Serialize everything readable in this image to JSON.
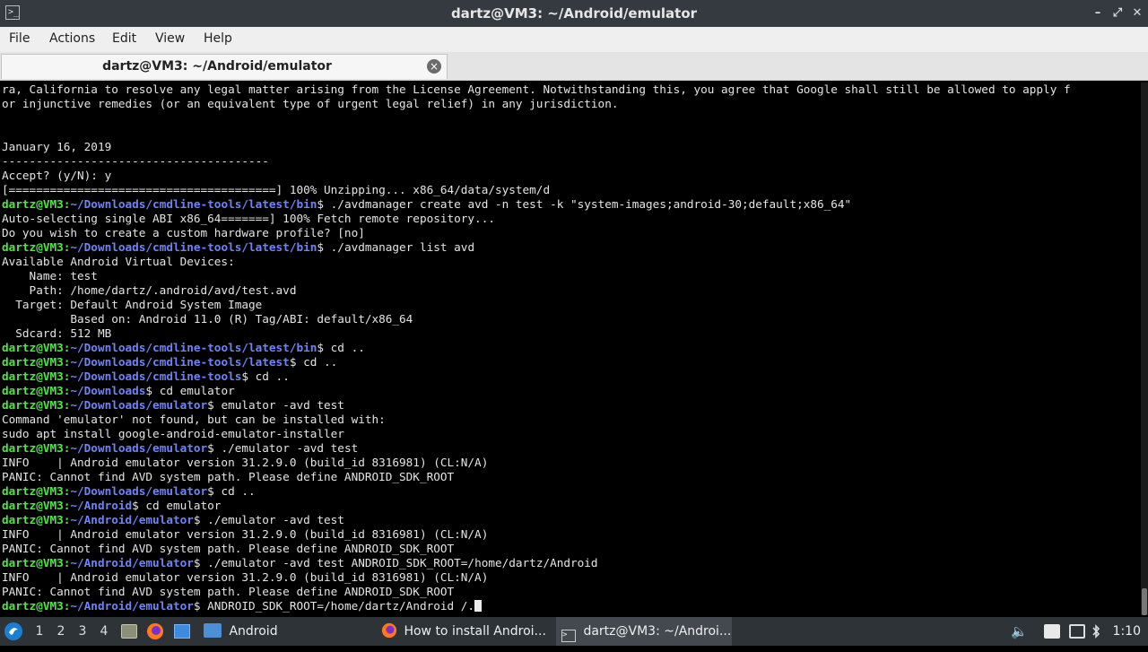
{
  "window": {
    "title": "dartz@VM3: ~/Android/emulator"
  },
  "menu": [
    "File",
    "Actions",
    "Edit",
    "View",
    "Help"
  ],
  "tab": {
    "label": "dartz@VM3: ~/Android/emulator"
  },
  "terminal": {
    "prompt_user": "dartz@VM3",
    "lines": [
      {
        "text": "ra, California to resolve any legal matter arising from the License Agreement. Notwithstanding this, you agree that Google shall still be allowed to apply f"
      },
      {
        "text": "or injunctive remedies (or an equivalent type of urgent legal relief) in any jurisdiction."
      },
      {
        "text": ""
      },
      {
        "text": ""
      },
      {
        "text": "January 16, 2019"
      },
      {
        "text": "---------------------------------------"
      },
      {
        "text": "Accept? (y/N): y"
      },
      {
        "text": "[=======================================] 100% Unzipping... x86_64/data/system/d"
      },
      {
        "path": "~/Downloads/cmdline-tools/latest/bin",
        "cmd": " ./avdmanager create avd -n test -k \"system-images;android-30;default;x86_64\""
      },
      {
        "text": "Auto-selecting single ABI x86_64=======] 100% Fetch remote repository..."
      },
      {
        "text": "Do you wish to create a custom hardware profile? [no]"
      },
      {
        "path": "~/Downloads/cmdline-tools/latest/bin",
        "cmd": " ./avdmanager list avd"
      },
      {
        "text": "Available Android Virtual Devices:"
      },
      {
        "text": "    Name: test"
      },
      {
        "text": "    Path: /home/dartz/.android/avd/test.avd"
      },
      {
        "text": "  Target: Default Android System Image"
      },
      {
        "text": "          Based on: Android 11.0 (R) Tag/ABI: default/x86_64"
      },
      {
        "text": "  Sdcard: 512 MB"
      },
      {
        "path": "~/Downloads/cmdline-tools/latest/bin",
        "cmd": " cd .."
      },
      {
        "path": "~/Downloads/cmdline-tools/latest",
        "cmd": " cd .."
      },
      {
        "path": "~/Downloads/cmdline-tools",
        "cmd": " cd .."
      },
      {
        "path": "~/Downloads",
        "cmd": " cd emulator"
      },
      {
        "path": "~/Downloads/emulator",
        "cmd": " emulator -avd test"
      },
      {
        "text": "Command 'emulator' not found, but can be installed with:"
      },
      {
        "text": "sudo apt install google-android-emulator-installer"
      },
      {
        "path": "~/Downloads/emulator",
        "cmd": " ./emulator -avd test"
      },
      {
        "text": "INFO    | Android emulator version 31.2.9.0 (build_id 8316981) (CL:N/A)"
      },
      {
        "text": "PANIC: Cannot find AVD system path. Please define ANDROID_SDK_ROOT"
      },
      {
        "path": "~/Downloads/emulator",
        "cmd": " cd .."
      },
      {
        "path": "~/Android",
        "cmd": " cd emulator"
      },
      {
        "path": "~/Android/emulator",
        "cmd": " ./emulator -avd test"
      },
      {
        "text": "INFO    | Android emulator version 31.2.9.0 (build_id 8316981) (CL:N/A)"
      },
      {
        "text": "PANIC: Cannot find AVD system path. Please define ANDROID_SDK_ROOT"
      },
      {
        "path": "~/Android/emulator",
        "cmd": " ./emulator -avd test ANDROID_SDK_ROOT=/home/dartz/Android"
      },
      {
        "text": "INFO    | Android emulator version 31.2.9.0 (build_id 8316981) (CL:N/A)"
      },
      {
        "text": "PANIC: Cannot find AVD system path. Please define ANDROID_SDK_ROOT"
      },
      {
        "path": "~/Android/emulator",
        "cmd": " ANDROID_SDK_ROOT=/home/dartz/Android /.",
        "cursor": true
      }
    ]
  },
  "taskbar": {
    "workspaces": [
      "1",
      "2",
      "3",
      "4"
    ],
    "active_workspace": "1",
    "folder_label": "Android",
    "tasks": [
      {
        "label": "How to install Androi...",
        "icon": "firefox-icon"
      },
      {
        "label": "dartz@VM3: ~/Androi...",
        "icon": "terminal-icon"
      }
    ],
    "clock": "1:10"
  },
  "colors": {
    "prompt_user": "#55e24a",
    "prompt_path": "#6f83f7",
    "terminal_bg": "#000000",
    "titlebar_bg": "#343a40",
    "taskbar_bg": "#2e3338"
  }
}
